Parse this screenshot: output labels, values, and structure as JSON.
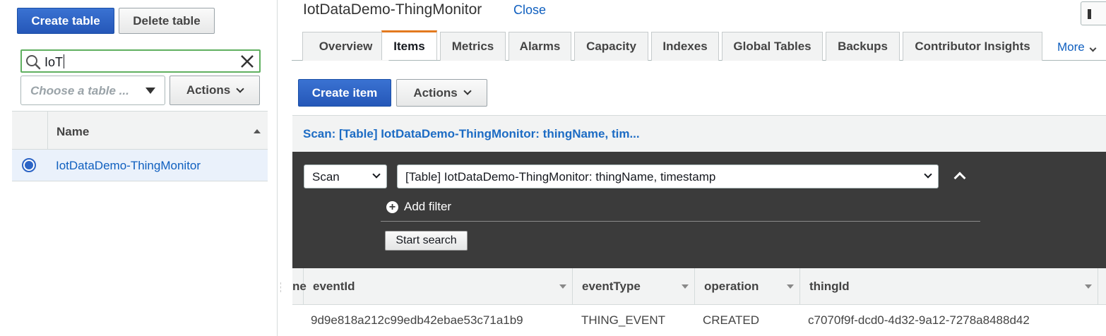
{
  "left_panel": {
    "create_table_label": "Create table",
    "delete_table_label": "Delete table",
    "search_value": "IoT",
    "table_select_placeholder": "Choose a table ...",
    "actions_label": "Actions",
    "table": {
      "column_header": "Name",
      "rows": [
        {
          "name": "IotDataDemo-ThingMonitor",
          "selected": true
        }
      ]
    }
  },
  "header": {
    "table_title": "IotDataDemo-ThingMonitor",
    "close_label": "Close"
  },
  "tabs": [
    "Overview",
    "Items",
    "Metrics",
    "Alarms",
    "Capacity",
    "Indexes",
    "Global Tables",
    "Backups",
    "Contributor Insights"
  ],
  "active_tab": "Items",
  "more_label": "More",
  "items_toolbar": {
    "create_item_label": "Create item",
    "actions_label": "Actions"
  },
  "scan": {
    "summary": "Scan: [Table] IotDataDemo-ThingMonitor: thingName, tim...",
    "mode": "Scan",
    "target": "[Table] IotDataDemo-ThingMonitor: thingName, timestamp",
    "add_filter_label": "Add filter",
    "start_search_label": "Start search"
  },
  "grid": {
    "partial_column_fragment": "ne",
    "columns": [
      "eventId",
      "eventType",
      "operation",
      "thingId"
    ],
    "rows": [
      [
        "9d9e818a212c99edb42ebae53c71a1b9",
        "THING_EVENT",
        "CREATED",
        "c7070f9f-dcd0-4d32-9a12-7278a8488d42"
      ]
    ]
  },
  "colors": {
    "primary_button": "#2c64c5",
    "link": "#0f5fbf",
    "active_tab_accent": "#e37a1f",
    "scan_panel_bg": "#3b3b3b",
    "search_focus_border": "#60b060"
  }
}
